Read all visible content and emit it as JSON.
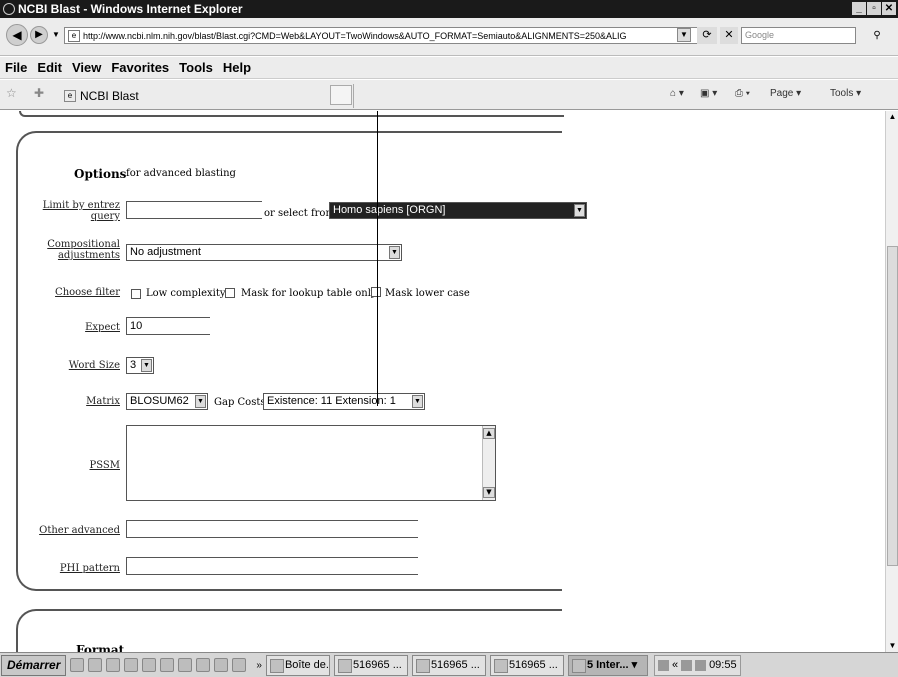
{
  "window": {
    "title": "NCBI Blast - Windows Internet Explorer"
  },
  "address": {
    "url": "http://www.ncbi.nlm.nih.gov/blast/Blast.cgi?CMD=Web&LAYOUT=TwoWindows&AUTO_FORMAT=Semiauto&ALIGNMENTS=250&ALIG",
    "search_placeholder": "Google"
  },
  "menu": [
    "File",
    "Edit",
    "View",
    "Favorites",
    "Tools",
    "Help"
  ],
  "tab": {
    "label": "NCBI Blast"
  },
  "commands": {
    "page": "Page ▾",
    "tools": "Tools ▾"
  },
  "options": {
    "heading": "Options",
    "subheading": "for advanced blasting",
    "limit_by_entrez_label": "Limit by entrez query",
    "limit_by_entrez_value": "",
    "select_from_text": "or select from:",
    "organism_value": "Homo sapiens [ORGN]",
    "compositional_label": "Compositional adjustments",
    "compositional_value": "No adjustment",
    "choose_filter_label": "Choose filter",
    "filter_low_complexity": "Low complexity",
    "filter_mask_lookup": "Mask for lookup table only",
    "filter_mask_lower": "Mask lower case",
    "expect_label": "Expect",
    "expect_value": "10",
    "word_size_label": "Word Size",
    "word_size_value": "3",
    "matrix_label": "Matrix",
    "matrix_value": "BLOSUM62",
    "gap_costs_label": "Gap Costs",
    "gap_costs_value": "Existence: 11 Extension: 1",
    "pssm_label": "PSSM",
    "other_advanced_label": "Other advanced",
    "phi_pattern_label": "PHI pattern"
  },
  "format": {
    "heading": "Format"
  },
  "taskbar": {
    "start": "Démarrer",
    "more": "»",
    "tasks": [
      "Boîte de...",
      "516965 ...",
      "516965 ...",
      "516965 ...",
      "5 Inter... ▾"
    ],
    "tray_more": "«",
    "clock": "09:55"
  }
}
